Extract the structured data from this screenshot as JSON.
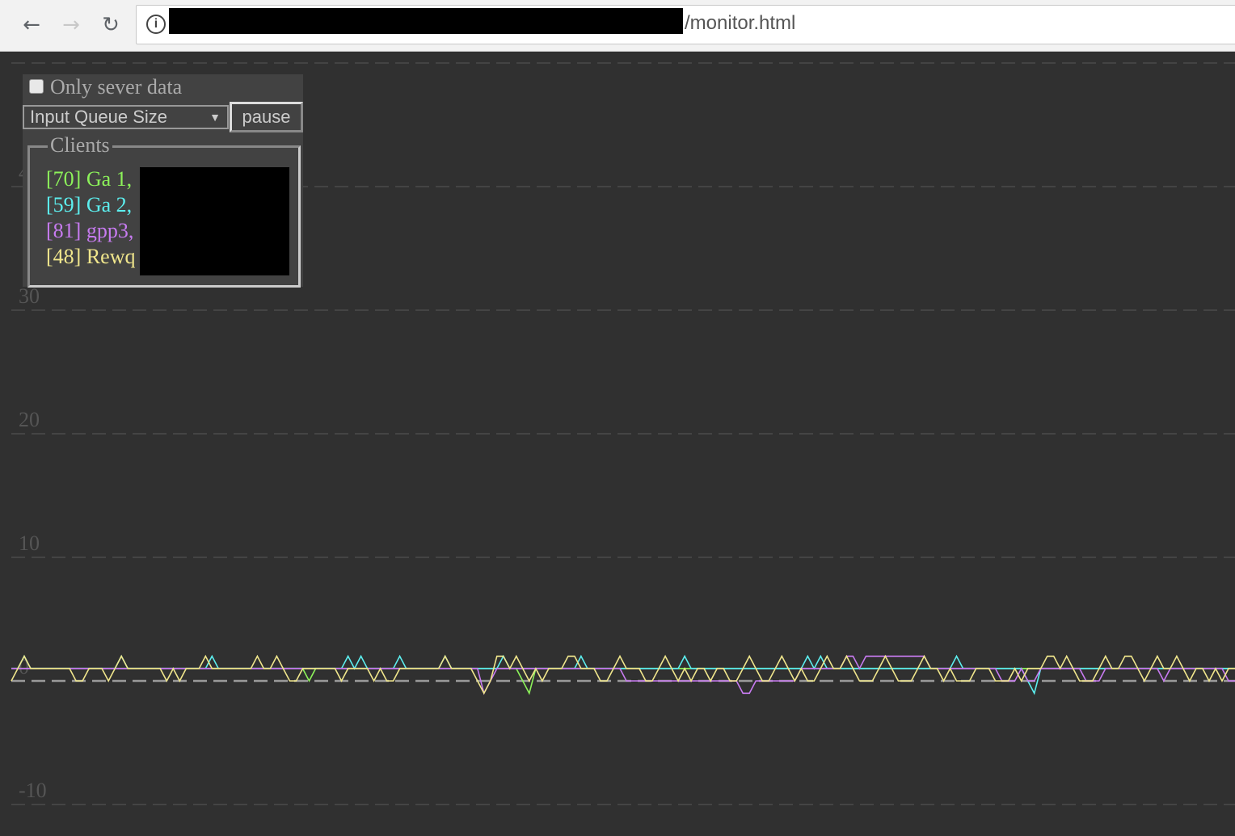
{
  "browser": {
    "back_icon": "arrow-left-icon",
    "forward_icon": "arrow-right-icon",
    "reload_icon": "reload-icon",
    "info_icon": "info-icon",
    "url_path": "/monitor.html"
  },
  "controls": {
    "only_server_label": "Only sever data",
    "only_server_checked": false,
    "metric_selected": "Input Queue Size",
    "pause_label": "pause"
  },
  "clients": {
    "legend": "Clients",
    "items": [
      {
        "label": "[70] Ga 1,",
        "color": "#8cf25a"
      },
      {
        "label": "[59] Ga 2,",
        "color": "#5cefef"
      },
      {
        "label": "[81] gpp3,",
        "color": "#c77bf0"
      },
      {
        "label": "[48] Rewq",
        "color": "#f0e68c"
      }
    ]
  },
  "chart_data": {
    "type": "line",
    "ylim": [
      -10,
      50
    ],
    "yticks": [
      50,
      40,
      30,
      20,
      10,
      0,
      -10
    ],
    "ytick_labels": [
      "40",
      "30",
      "20",
      "10",
      "0",
      "-10"
    ],
    "grid": true,
    "series": [
      {
        "color": "#8cf25a",
        "values": [
          1,
          1,
          1,
          1,
          1,
          1,
          1,
          1,
          1,
          1,
          1,
          1,
          1,
          1,
          1,
          1,
          1,
          1,
          1,
          1,
          1,
          1,
          1,
          1,
          1,
          1,
          1,
          1,
          1,
          1,
          1,
          1,
          1,
          1,
          1,
          1,
          1,
          1,
          1,
          1,
          1,
          1,
          1,
          1,
          1,
          1,
          0,
          1,
          1,
          1,
          1,
          1,
          1,
          1,
          1,
          1,
          1,
          1,
          1,
          1,
          1,
          1,
          1,
          1,
          1,
          1,
          1,
          1,
          1,
          1,
          1,
          1,
          1,
          1,
          1,
          1,
          1,
          1,
          1,
          0,
          -1,
          1,
          1,
          1,
          1,
          1,
          1,
          1,
          1,
          1,
          1,
          1,
          1,
          1,
          1,
          1,
          1,
          1,
          1,
          1,
          1,
          1,
          1,
          1,
          1,
          1,
          1,
          1,
          1,
          1,
          1,
          1,
          1,
          1,
          1,
          1,
          1,
          1,
          1,
          1,
          1,
          1,
          1,
          1,
          1,
          1,
          1,
          1,
          1,
          1,
          1,
          1,
          1,
          1,
          1,
          1,
          1,
          1,
          1,
          1,
          1,
          1,
          1,
          1,
          1,
          1,
          1,
          1,
          1,
          1,
          1,
          1,
          1,
          1,
          1,
          1,
          1,
          1,
          1,
          1,
          1,
          1,
          1,
          1,
          1,
          1,
          1,
          1,
          1,
          1,
          1,
          1,
          1,
          1,
          1,
          1,
          1,
          1,
          1,
          1,
          1,
          1,
          1,
          1,
          1,
          1,
          1,
          1,
          1,
          1
        ]
      },
      {
        "color": "#5cefef",
        "values": [
          1,
          1,
          2,
          1,
          1,
          1,
          1,
          1,
          1,
          1,
          1,
          1,
          1,
          1,
          1,
          1,
          1,
          2,
          1,
          1,
          1,
          1,
          1,
          1,
          1,
          1,
          1,
          1,
          1,
          1,
          1,
          2,
          1,
          1,
          1,
          1,
          1,
          1,
          1,
          1,
          1,
          1,
          1,
          1,
          1,
          1,
          1,
          1,
          1,
          1,
          1,
          1,
          2,
          1,
          2,
          1,
          1,
          1,
          1,
          1,
          2,
          1,
          1,
          1,
          1,
          1,
          1,
          2,
          1,
          1,
          1,
          1,
          1,
          1,
          1,
          1,
          2,
          1,
          1,
          1,
          1,
          1,
          1,
          1,
          1,
          1,
          1,
          1,
          2,
          1,
          1,
          1,
          1,
          1,
          1,
          1,
          1,
          1,
          1,
          1,
          1,
          1,
          1,
          1,
          2,
          1,
          1,
          1,
          1,
          1,
          1,
          1,
          1,
          1,
          1,
          1,
          1,
          1,
          1,
          1,
          1,
          1,
          1,
          2,
          1,
          2,
          1,
          1,
          1,
          1,
          1,
          1,
          1,
          1,
          1,
          1,
          1,
          1,
          1,
          1,
          1,
          1,
          1,
          1,
          1,
          1,
          2,
          1,
          1,
          1,
          1,
          1,
          1,
          1,
          1,
          1,
          1,
          0,
          -1,
          1,
          1,
          1,
          1,
          1,
          1,
          1,
          1,
          1,
          1,
          1,
          1,
          1,
          1,
          1,
          1,
          1,
          1,
          1,
          1,
          1,
          1,
          1,
          1,
          1,
          1,
          1,
          1,
          1,
          1,
          1
        ]
      },
      {
        "color": "#c77bf0",
        "values": [
          1,
          1,
          1,
          1,
          1,
          1,
          1,
          1,
          1,
          1,
          1,
          1,
          1,
          1,
          1,
          1,
          1,
          1,
          1,
          1,
          1,
          1,
          1,
          1,
          1,
          1,
          1,
          1,
          1,
          1,
          1,
          1,
          1,
          1,
          1,
          1,
          1,
          1,
          1,
          1,
          1,
          1,
          1,
          1,
          1,
          1,
          1,
          1,
          1,
          1,
          1,
          1,
          1,
          1,
          1,
          1,
          1,
          1,
          1,
          1,
          1,
          1,
          1,
          1,
          1,
          1,
          1,
          1,
          1,
          1,
          1,
          1,
          1,
          -1,
          0,
          1,
          1,
          1,
          1,
          1,
          1,
          1,
          1,
          1,
          1,
          1,
          1,
          1,
          1,
          1,
          1,
          1,
          1,
          1,
          1,
          0,
          0,
          0,
          0,
          0,
          0,
          0,
          0,
          0,
          0,
          0,
          0,
          0,
          0,
          0,
          0,
          0,
          0,
          -1,
          -1,
          0,
          0,
          0,
          0,
          0,
          0,
          0,
          1,
          1,
          1,
          1,
          1,
          1,
          1,
          2,
          2,
          1,
          2,
          2,
          2,
          2,
          2,
          2,
          2,
          2,
          2,
          2,
          1,
          1,
          1,
          1,
          1,
          1,
          1,
          1,
          1,
          1,
          1,
          0,
          0,
          0,
          1,
          0,
          0,
          1,
          1,
          1,
          1,
          1,
          1,
          1,
          0,
          0,
          0,
          1,
          1,
          1,
          1,
          1,
          1,
          1,
          1,
          1,
          0,
          1,
          1,
          1,
          1,
          1,
          1,
          1,
          1,
          1,
          0,
          0
        ]
      },
      {
        "color": "#f0e68c",
        "values": [
          0,
          1,
          2,
          1,
          1,
          1,
          1,
          1,
          1,
          1,
          0,
          0,
          1,
          1,
          1,
          0,
          1,
          2,
          1,
          1,
          1,
          1,
          1,
          1,
          0,
          1,
          0,
          1,
          1,
          1,
          2,
          1,
          1,
          1,
          1,
          1,
          1,
          1,
          2,
          1,
          1,
          2,
          1,
          0,
          0,
          1,
          1,
          1,
          1,
          1,
          1,
          0,
          1,
          1,
          1,
          1,
          0,
          1,
          0,
          0,
          1,
          1,
          1,
          1,
          1,
          1,
          1,
          2,
          1,
          1,
          1,
          1,
          0,
          -1,
          0,
          2,
          2,
          1,
          2,
          1,
          0,
          1,
          0,
          1,
          1,
          1,
          2,
          2,
          1,
          1,
          1,
          0,
          0,
          1,
          2,
          1,
          1,
          1,
          0,
          0,
          1,
          2,
          1,
          0,
          1,
          0,
          1,
          1,
          0,
          1,
          1,
          0,
          0,
          1,
          2,
          1,
          0,
          0,
          1,
          2,
          1,
          0,
          1,
          0,
          0,
          1,
          2,
          1,
          1,
          2,
          1,
          0,
          0,
          0,
          1,
          2,
          1,
          0,
          0,
          0,
          1,
          2,
          1,
          1,
          0,
          1,
          0,
          0,
          0,
          1,
          1,
          1,
          0,
          0,
          0,
          1,
          0,
          1,
          1,
          1,
          2,
          2,
          1,
          2,
          1,
          0,
          0,
          0,
          1,
          2,
          1,
          1,
          2,
          2,
          1,
          0,
          1,
          2,
          1,
          1,
          2,
          1,
          0,
          1,
          1,
          0,
          1,
          0,
          1,
          1
        ]
      }
    ]
  }
}
